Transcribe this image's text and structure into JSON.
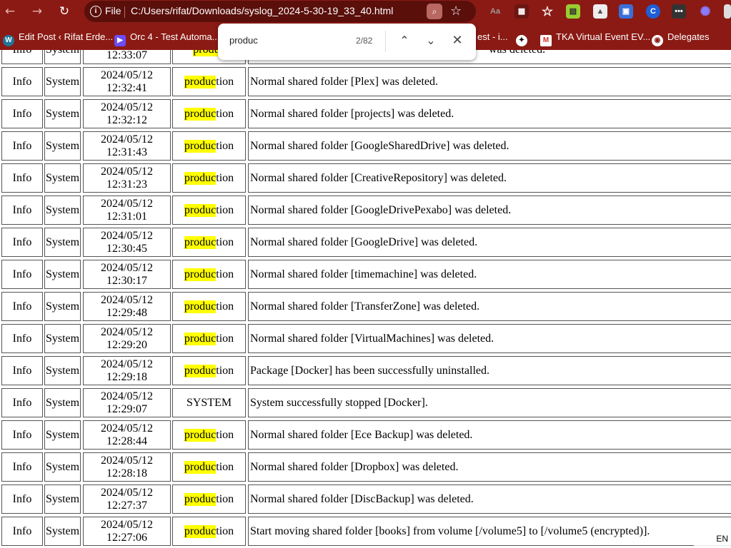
{
  "browser": {
    "address": {
      "scheme_label": "File",
      "url": "C:/Users/rifat/Downloads/syslog_2024-5-30-19_33_40.html"
    },
    "bookmarks": [
      {
        "label": "Edit Post ‹ Rifat Erde...",
        "icon": "wordpress-icon"
      },
      {
        "label": "Orc 4 - Test Automa...",
        "icon": "video-icon"
      },
      {
        "label": "est - i...",
        "icon": "partial-bookmark"
      },
      {
        "label": "",
        "icon": "openai-icon"
      },
      {
        "label": "TKA Virtual Event EV...",
        "icon": "gmail-icon"
      },
      {
        "label": "Delegates",
        "icon": "globe-icon"
      }
    ],
    "colors": {
      "toolbar": "#8b1a14",
      "omnibox": "#5a0f0b",
      "highlight": "#ffff00"
    }
  },
  "find": {
    "query": "produc",
    "count": "2/82"
  },
  "log": {
    "partial_top": {
      "level": "Info",
      "category": "System",
      "time": "12:33:07",
      "user": "produc",
      "event": "was deleted."
    },
    "rows": [
      {
        "level": "Info",
        "category": "System",
        "date": "2024/05/12",
        "time": "12:32:41",
        "user": "production",
        "match": true,
        "event": "Normal shared folder [Plex] was deleted."
      },
      {
        "level": "Info",
        "category": "System",
        "date": "2024/05/12",
        "time": "12:32:12",
        "user": "production",
        "match": true,
        "event": "Normal shared folder [projects] was deleted."
      },
      {
        "level": "Info",
        "category": "System",
        "date": "2024/05/12",
        "time": "12:31:43",
        "user": "production",
        "match": true,
        "event": "Normal shared folder [GoogleSharedDrive] was deleted."
      },
      {
        "level": "Info",
        "category": "System",
        "date": "2024/05/12",
        "time": "12:31:23",
        "user": "production",
        "match": true,
        "event": "Normal shared folder [CreativeRepository] was deleted."
      },
      {
        "level": "Info",
        "category": "System",
        "date": "2024/05/12",
        "time": "12:31:01",
        "user": "production",
        "match": true,
        "event": "Normal shared folder [GoogleDrivePexabo] was deleted."
      },
      {
        "level": "Info",
        "category": "System",
        "date": "2024/05/12",
        "time": "12:30:45",
        "user": "production",
        "match": true,
        "event": "Normal shared folder [GoogleDrive] was deleted."
      },
      {
        "level": "Info",
        "category": "System",
        "date": "2024/05/12",
        "time": "12:30:17",
        "user": "production",
        "match": true,
        "event": "Normal shared folder [timemachine] was deleted."
      },
      {
        "level": "Info",
        "category": "System",
        "date": "2024/05/12",
        "time": "12:29:48",
        "user": "production",
        "match": true,
        "event": "Normal shared folder [TransferZone] was deleted."
      },
      {
        "level": "Info",
        "category": "System",
        "date": "2024/05/12",
        "time": "12:29:20",
        "user": "production",
        "match": true,
        "event": "Normal shared folder [VirtualMachines] was deleted."
      },
      {
        "level": "Info",
        "category": "System",
        "date": "2024/05/12",
        "time": "12:29:18",
        "user": "production",
        "match": true,
        "event": "Package [Docker] has been successfully uninstalled."
      },
      {
        "level": "Info",
        "category": "System",
        "date": "2024/05/12",
        "time": "12:29:07",
        "user": "SYSTEM",
        "match": false,
        "event": "System successfully stopped [Docker]."
      },
      {
        "level": "Info",
        "category": "System",
        "date": "2024/05/12",
        "time": "12:28:44",
        "user": "production",
        "match": true,
        "event": "Normal shared folder [Ece Backup] was deleted."
      },
      {
        "level": "Info",
        "category": "System",
        "date": "2024/05/12",
        "time": "12:28:18",
        "user": "production",
        "match": true,
        "event": "Normal shared folder [Dropbox] was deleted."
      },
      {
        "level": "Info",
        "category": "System",
        "date": "2024/05/12",
        "time": "12:27:37",
        "user": "production",
        "match": true,
        "event": "Normal shared folder [DiscBackup] was deleted."
      },
      {
        "level": "Info",
        "category": "System",
        "date": "2024/05/12",
        "time": "12:27:06",
        "user": "production",
        "match": true,
        "event": "Start moving shared folder [books] from volume [/volume5] to [/volume5 (encrypted)]."
      }
    ]
  },
  "taskbar_fragment": "EN"
}
